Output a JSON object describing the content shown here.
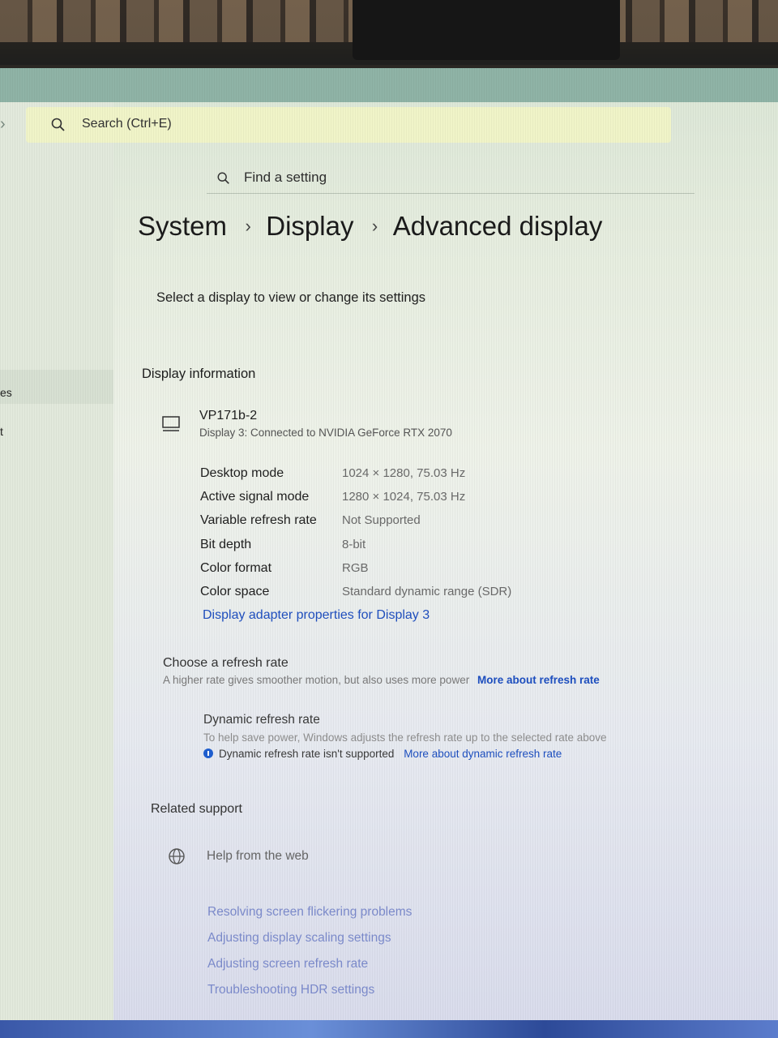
{
  "search": {
    "placeholder": "Search (Ctrl+E)"
  },
  "find_setting": {
    "placeholder": "Find a setting"
  },
  "breadcrumb": {
    "level1": "System",
    "level2": "Display",
    "level3": "Advanced display",
    "separator": "›"
  },
  "edge_labels": [
    "es",
    "t"
  ],
  "subtitle": "Select a display to view or change its settings",
  "display_information": {
    "heading": "Display information",
    "display_name": "VP171b-2",
    "display_description": "Display 3: Connected to NVIDIA GeForce RTX 2070",
    "rows": [
      {
        "label": "Desktop mode",
        "value": "1024 × 1280, 75.03 Hz"
      },
      {
        "label": "Active signal mode",
        "value": "1280 × 1024, 75.03 Hz"
      },
      {
        "label": "Variable refresh rate",
        "value": "Not Supported"
      },
      {
        "label": "Bit depth",
        "value": "8-bit"
      },
      {
        "label": "Color format",
        "value": "RGB"
      },
      {
        "label": "Color space",
        "value": "Standard dynamic range (SDR)"
      }
    ],
    "adapter_link": "Display adapter properties for Display 3"
  },
  "refresh_rate": {
    "title": "Choose a refresh rate",
    "description": "A higher rate gives smoother motion, but also uses more power",
    "link": "More about refresh rate"
  },
  "dynamic_refresh": {
    "title": "Dynamic refresh rate",
    "description": "To help save power, Windows adjusts the refresh rate up to the selected rate above",
    "note": "Dynamic refresh rate isn't supported",
    "link": "More about dynamic refresh rate"
  },
  "related_support": {
    "heading": "Related support",
    "help_item": "Help from the web",
    "links": [
      "Resolving screen flickering problems",
      "Adjusting display scaling settings",
      "Adjusting screen refresh rate",
      "Troubleshooting HDR settings"
    ]
  },
  "colors": {
    "accent": "#1f4fbf",
    "search_highlight": "#f0f4c8"
  }
}
